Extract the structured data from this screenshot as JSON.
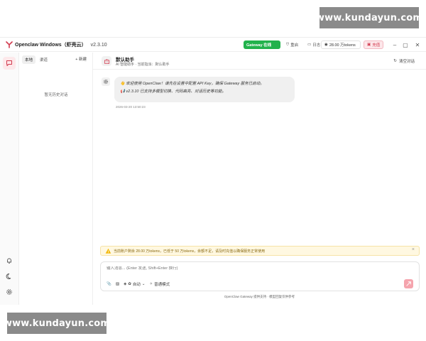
{
  "watermark": "www.kundayun.com",
  "titlebar": {
    "app_name": "Openclaw Windows（虾壳云）",
    "version": "v2.3.10",
    "gateway": "Gateway 在线",
    "restart": "重启",
    "log": "日志",
    "tokens": "28.00 万tokens",
    "recharge": "充值"
  },
  "sidebar": {
    "tab_local": "本地",
    "tab_channel": "渠道",
    "new_label": "+ 新建",
    "empty_text": "暂无历史对话"
  },
  "chat": {
    "bot_name": "默认助手",
    "bot_subtitle": "AI 智能助手 · 当前指派：默认助手",
    "clear_label": "清空对话",
    "messages": [
      {
        "line1": "欢迎使用 OpenClaw！请先在设置中配置 API Key，确保 Gateway 服务已启动。",
        "line2": "v2.3.10 已支持多模型切换、代码高亮、对话历史等功能。",
        "time": "2026-03-20 13:50:23"
      }
    ]
  },
  "warning": {
    "text": "当前账户剩余 28.00 万tokens，已低于 50 万tokens，余额不足，请及时充值以确保服务正常使用"
  },
  "composer": {
    "placeholder": "输入消息... (Enter 发送, Shift+Enter 换行)",
    "model_label": "自动",
    "mode_label": "普通模式"
  },
  "footer": "OpenClaw Gateway 提供支持 · 模型回复仅供参考",
  "colors": {
    "accent": "#e0394f",
    "gateway_green": "#22b24c",
    "warning_bg": "#fff8e1"
  }
}
